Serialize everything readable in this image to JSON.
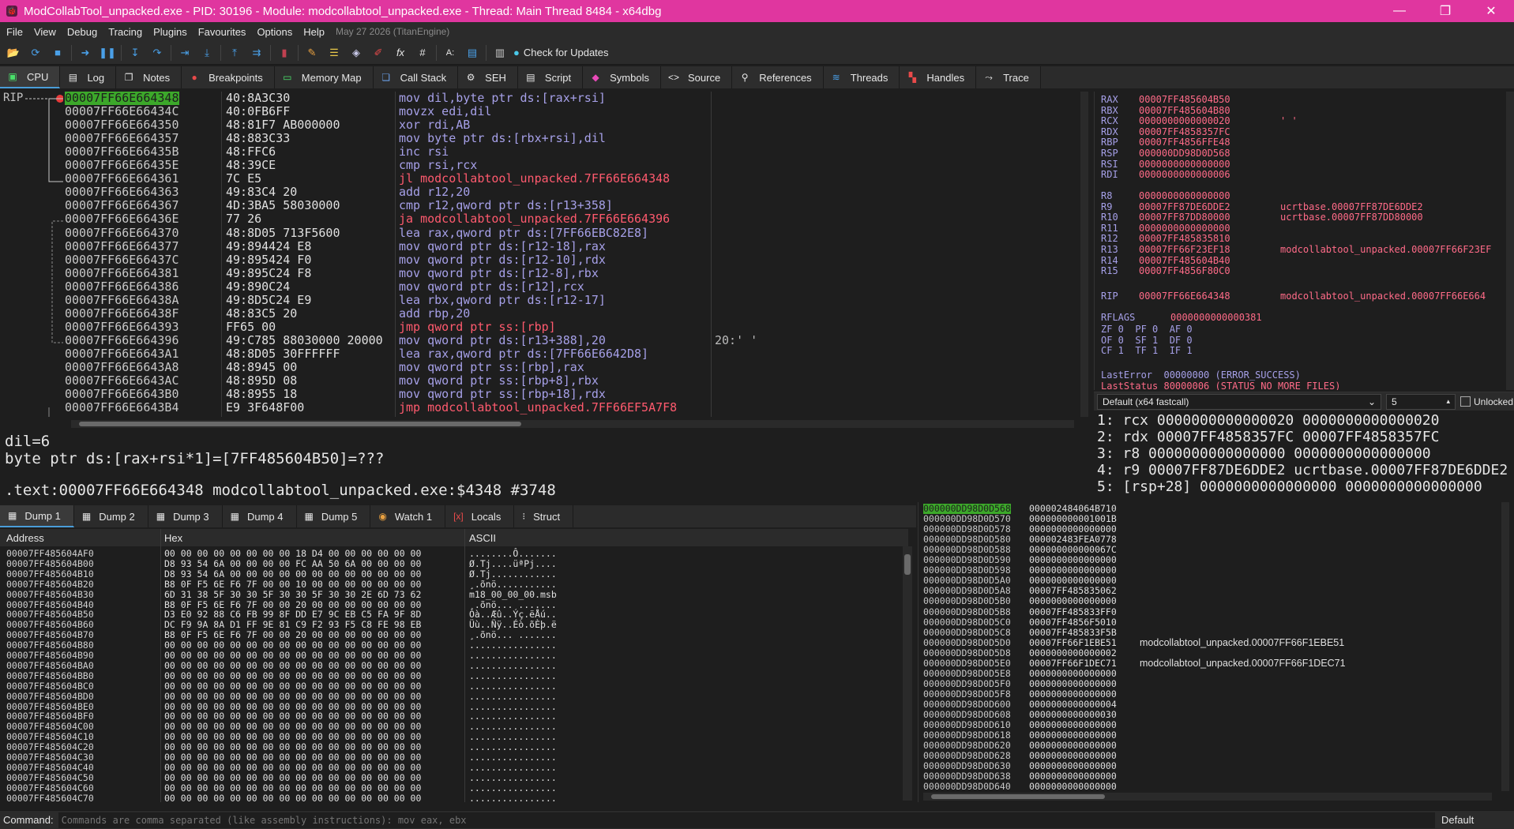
{
  "window": {
    "title": "ModCollabTool_unpacked.exe - PID: 30196 - Module: modcollabtool_unpacked.exe - Thread: Main Thread 8484 - x64dbg",
    "controls": [
      "—",
      "❐",
      "✕"
    ]
  },
  "menu": {
    "items": [
      "File",
      "View",
      "Debug",
      "Tracing",
      "Plugins",
      "Favourites",
      "Options",
      "Help"
    ],
    "date": "May 27 2026 (TitanEngine)"
  },
  "toolbar": {
    "check_updates": "Check for Updates"
  },
  "tabs": [
    "CPU",
    "Log",
    "Notes",
    "Breakpoints",
    "Memory Map",
    "Call Stack",
    "SEH",
    "Script",
    "Symbols",
    "Source",
    "References",
    "Threads",
    "Handles",
    "Trace"
  ],
  "disasm": {
    "rip_label": "RIP",
    "lines": [
      {
        "addr": "00007FF66E664348",
        "bytes": "40:8A3C30",
        "mnem": "mov",
        "ops": " dil,byte ptr ds:[rax+rsi]",
        "type": "mov",
        "cmt": ""
      },
      {
        "addr": "00007FF66E66434C",
        "bytes": "40:0FB6FF",
        "mnem": "movzx",
        "ops": " edi,dil",
        "type": "mov",
        "cmt": ""
      },
      {
        "addr": "00007FF66E664350",
        "bytes": "48:81F7 AB000000",
        "mnem": "xor",
        "ops": " rdi,AB",
        "type": "mov",
        "cmt": ""
      },
      {
        "addr": "00007FF66E664357",
        "bytes": "48:883C33",
        "mnem": "mov",
        "ops": " byte ptr ds:[rbx+rsi],dil",
        "type": "mov",
        "cmt": ""
      },
      {
        "addr": "00007FF66E66435B",
        "bytes": "48:FFC6",
        "mnem": "inc",
        "ops": " rsi",
        "type": "mov",
        "cmt": ""
      },
      {
        "addr": "00007FF66E66435E",
        "bytes": "48:39CE",
        "mnem": "cmp",
        "ops": " rsi,rcx",
        "type": "mov",
        "cmt": ""
      },
      {
        "addr": "00007FF66E664361",
        "bytes": "7C E5",
        "mnem": "jl",
        "ops": " modcollabtool_unpacked.7FF66E664348",
        "type": "jmp",
        "cmt": ""
      },
      {
        "addr": "00007FF66E664363",
        "bytes": "49:83C4 20",
        "mnem": "add",
        "ops": " r12,20",
        "type": "mov",
        "cmt": ""
      },
      {
        "addr": "00007FF66E664367",
        "bytes": "4D:3BA5 58030000",
        "mnem": "cmp",
        "ops": " r12,qword ptr ds:[r13+358]",
        "type": "mov",
        "cmt": ""
      },
      {
        "addr": "00007FF66E66436E",
        "bytes": "77 26",
        "mnem": "ja",
        "ops": " modcollabtool_unpacked.7FF66E664396",
        "type": "jmp",
        "cmt": ""
      },
      {
        "addr": "00007FF66E664370",
        "bytes": "48:8D05 713F5600",
        "mnem": "lea",
        "ops": " rax,qword ptr ds:[7FF66EBC82E8]",
        "type": "mov",
        "cmt": ""
      },
      {
        "addr": "00007FF66E664377",
        "bytes": "49:894424 E8",
        "mnem": "mov",
        "ops": " qword ptr ds:[r12-18],rax",
        "type": "mov",
        "cmt": ""
      },
      {
        "addr": "00007FF66E66437C",
        "bytes": "49:895424 F0",
        "mnem": "mov",
        "ops": " qword ptr ds:[r12-10],rdx",
        "type": "mov",
        "cmt": ""
      },
      {
        "addr": "00007FF66E664381",
        "bytes": "49:895C24 F8",
        "mnem": "mov",
        "ops": " qword ptr ds:[r12-8],rbx",
        "type": "mov",
        "cmt": ""
      },
      {
        "addr": "00007FF66E664386",
        "bytes": "49:890C24",
        "mnem": "mov",
        "ops": " qword ptr ds:[r12],rcx",
        "type": "mov",
        "cmt": ""
      },
      {
        "addr": "00007FF66E66438A",
        "bytes": "49:8D5C24 E9",
        "mnem": "lea",
        "ops": " rbx,qword ptr ds:[r12-17]",
        "type": "mov",
        "cmt": ""
      },
      {
        "addr": "00007FF66E66438F",
        "bytes": "48:83C5 20",
        "mnem": "add",
        "ops": " rbp,20",
        "type": "mov",
        "cmt": ""
      },
      {
        "addr": "00007FF66E664393",
        "bytes": "FF65 00",
        "mnem": "jmp",
        "ops": " qword ptr ss:[rbp]",
        "type": "jmp",
        "cmt": ""
      },
      {
        "addr": "00007FF66E664396",
        "bytes": "49:C785 88030000 20000",
        "mnem": "mov",
        "ops": " qword ptr ds:[r13+388],20",
        "type": "mov",
        "cmt": "20:' '"
      },
      {
        "addr": "00007FF66E6643A1",
        "bytes": "48:8D05 30FFFFFF",
        "mnem": "lea",
        "ops": " rax,qword ptr ds:[7FF66E6642D8]",
        "type": "mov",
        "cmt": ""
      },
      {
        "addr": "00007FF66E6643A8",
        "bytes": "48:8945 00",
        "mnem": "mov",
        "ops": " qword ptr ss:[rbp],rax",
        "type": "mov",
        "cmt": ""
      },
      {
        "addr": "00007FF66E6643AC",
        "bytes": "48:895D 08",
        "mnem": "mov",
        "ops": " qword ptr ss:[rbp+8],rbx",
        "type": "mov",
        "cmt": ""
      },
      {
        "addr": "00007FF66E6643B0",
        "bytes": "48:8955 18",
        "mnem": "mov",
        "ops": " qword ptr ss:[rbp+18],rdx",
        "type": "mov",
        "cmt": ""
      },
      {
        "addr": "00007FF66E6643B4",
        "bytes": "E9 3F648F00",
        "mnem": "jmp",
        "ops": " modcollabtool_unpacked.7FF66EF5A7F8",
        "type": "jmp",
        "cmt": ""
      }
    ]
  },
  "info": {
    "line1": "dil=6",
    "line2": "byte ptr ds:[rax+rsi*1]=[7FF485604B50]=???",
    "line3": ".text:00007FF66E664348 modcollabtool_unpacked.exe:$4348 #3748"
  },
  "registers": {
    "gp": [
      {
        "name": "RAX",
        "value": "00007FF485604B50",
        "extra": ""
      },
      {
        "name": "RBX",
        "value": "00007FF485604B80",
        "extra": ""
      },
      {
        "name": "RCX",
        "value": "0000000000000020",
        "extra": "' '"
      },
      {
        "name": "RDX",
        "value": "00007FF4858357FC",
        "extra": ""
      },
      {
        "name": "RBP",
        "value": "00007FF4856FFE48",
        "extra": ""
      },
      {
        "name": "RSP",
        "value": "000000DD98D0D568",
        "extra": ""
      },
      {
        "name": "RSI",
        "value": "0000000000000000",
        "extra": ""
      },
      {
        "name": "RDI",
        "value": "0000000000000006",
        "extra": ""
      }
    ],
    "ext": [
      {
        "name": "R8",
        "value": "0000000000000000",
        "extra": ""
      },
      {
        "name": "R9",
        "value": "00007FF87DE6DDE2",
        "extra": "ucrtbase.00007FF87DE6DDE2"
      },
      {
        "name": "R10",
        "value": "00007FF87DD80000",
        "extra": "ucrtbase.00007FF87DD80000"
      },
      {
        "name": "R11",
        "value": "0000000000000000",
        "extra": ""
      },
      {
        "name": "R12",
        "value": "00007FF485835810",
        "extra": ""
      },
      {
        "name": "R13",
        "value": "00007FF66F23EF18",
        "extra": "modcollabtool_unpacked.00007FF66F23EF"
      },
      {
        "name": "R14",
        "value": "00007FF485604B40",
        "extra": ""
      },
      {
        "name": "R15",
        "value": "00007FF4856F80C0",
        "extra": ""
      }
    ],
    "rip": {
      "name": "RIP",
      "value": "00007FF66E664348",
      "extra": "modcollabtool_unpacked.00007FF66E664"
    },
    "rflags_label": "RFLAGS",
    "rflags_value": "0000000000000381",
    "flags": [
      "ZF 0  PF 0  AF 0",
      "OF 0  SF 1  DF 0",
      "CF 1  TF 1  IF 1"
    ],
    "last_error": "LastError  00000000 (ERROR_SUCCESS)",
    "last_status": "LastStatus 80000006 (STATUS_NO_MORE_FILES)"
  },
  "callconv": {
    "convention": "Default (x64 fastcall)",
    "count": "5",
    "unlocked": "Unlocked",
    "args": [
      "1: rcx 0000000000000020 0000000000000020",
      "2: rdx 00007FF4858357FC 00007FF4858357FC",
      "3: r8 0000000000000000 0000000000000000",
      "4: r9 00007FF87DE6DDE2 ucrtbase.00007FF87DE6DDE2",
      "5: [rsp+28] 0000000000000000 0000000000000000"
    ]
  },
  "dumptabs": [
    "Dump 1",
    "Dump 2",
    "Dump 3",
    "Dump 4",
    "Dump 5",
    "Watch 1",
    "Locals",
    "Struct"
  ],
  "dump": {
    "headers": {
      "address": "Address",
      "hex": "Hex",
      "ascii": "ASCII"
    },
    "rows": [
      {
        "a": "00007FF485604AF0",
        "h": "00 00 00 00 00 00 00 00 18 D4 00 00 00 00 00 00",
        "s": "........Ô......."
      },
      {
        "a": "00007FF485604B00",
        "h": "D8 93 54 6A 00 00 00 00 FC AA 50 6A 00 00 00 00",
        "s": "Ø.Tj....üªPj...."
      },
      {
        "a": "00007FF485604B10",
        "h": "D8 93 54 6A 00 00 00 00 00 00 00 00 00 00 00 00",
        "s": "Ø.Tj............"
      },
      {
        "a": "00007FF485604B20",
        "h": "B8 0F F5 6E F6 7F 00 00 10 00 00 00 00 00 00 00",
        "s": "¸.õnö..........."
      },
      {
        "a": "00007FF485604B30",
        "h": "6D 31 38 5F 30 30 5F 30 30 5F 30 30 2E 6D 73 62",
        "s": "m18_00_00_00.msb"
      },
      {
        "a": "00007FF485604B40",
        "h": "B8 0F F5 6E F6 7F 00 00 20 00 00 00 00 00 00 00",
        "s": "¸.õnö... ......."
      },
      {
        "a": "00007FF485604B50",
        "h": "D3 E0 92 88 C6 FB 99 8F DD E7 9C EB C5 FA 9F 8D",
        "s": "Óà..Æû..Ýç.ëÅú.."
      },
      {
        "a": "00007FF485604B60",
        "h": "DC F9 9A 8A D1 FF 9E 81 C9 F2 93 F5 C8 FE 98 EB",
        "s": "Üù..Ñÿ..Éò.õÈþ.ë"
      },
      {
        "a": "00007FF485604B70",
        "h": "B8 0F F5 6E F6 7F 00 00 20 00 00 00 00 00 00 00",
        "s": "¸.õnö... ......."
      },
      {
        "a": "00007FF485604B80",
        "h": "00 00 00 00 00 00 00 00 00 00 00 00 00 00 00 00",
        "s": "................"
      },
      {
        "a": "00007FF485604B90",
        "h": "00 00 00 00 00 00 00 00 00 00 00 00 00 00 00 00",
        "s": "................"
      },
      {
        "a": "00007FF485604BA0",
        "h": "00 00 00 00 00 00 00 00 00 00 00 00 00 00 00 00",
        "s": "................"
      },
      {
        "a": "00007FF485604BB0",
        "h": "00 00 00 00 00 00 00 00 00 00 00 00 00 00 00 00",
        "s": "................"
      },
      {
        "a": "00007FF485604BC0",
        "h": "00 00 00 00 00 00 00 00 00 00 00 00 00 00 00 00",
        "s": "................"
      },
      {
        "a": "00007FF485604BD0",
        "h": "00 00 00 00 00 00 00 00 00 00 00 00 00 00 00 00",
        "s": "................"
      },
      {
        "a": "00007FF485604BE0",
        "h": "00 00 00 00 00 00 00 00 00 00 00 00 00 00 00 00",
        "s": "................"
      },
      {
        "a": "00007FF485604BF0",
        "h": "00 00 00 00 00 00 00 00 00 00 00 00 00 00 00 00",
        "s": "................"
      },
      {
        "a": "00007FF485604C00",
        "h": "00 00 00 00 00 00 00 00 00 00 00 00 00 00 00 00",
        "s": "................"
      },
      {
        "a": "00007FF485604C10",
        "h": "00 00 00 00 00 00 00 00 00 00 00 00 00 00 00 00",
        "s": "................"
      },
      {
        "a": "00007FF485604C20",
        "h": "00 00 00 00 00 00 00 00 00 00 00 00 00 00 00 00",
        "s": "................"
      },
      {
        "a": "00007FF485604C30",
        "h": "00 00 00 00 00 00 00 00 00 00 00 00 00 00 00 00",
        "s": "................"
      },
      {
        "a": "00007FF485604C40",
        "h": "00 00 00 00 00 00 00 00 00 00 00 00 00 00 00 00",
        "s": "................"
      },
      {
        "a": "00007FF485604C50",
        "h": "00 00 00 00 00 00 00 00 00 00 00 00 00 00 00 00",
        "s": "................"
      },
      {
        "a": "00007FF485604C60",
        "h": "00 00 00 00 00 00 00 00 00 00 00 00 00 00 00 00",
        "s": "................"
      },
      {
        "a": "00007FF485604C70",
        "h": "00 00 00 00 00 00 00 00 00 00 00 00 00 00 00 00",
        "s": "................"
      }
    ]
  },
  "stack": {
    "rows": [
      {
        "a": "000000DD98D0D568",
        "v": "000002484064B710",
        "c": ""
      },
      {
        "a": "000000DD98D0D570",
        "v": "000000000001001B",
        "c": ""
      },
      {
        "a": "000000DD98D0D578",
        "v": "0000000000000000",
        "c": ""
      },
      {
        "a": "000000DD98D0D580",
        "v": "000002483FEA0778",
        "c": ""
      },
      {
        "a": "000000DD98D0D588",
        "v": "000000000000067C",
        "c": ""
      },
      {
        "a": "000000DD98D0D590",
        "v": "0000000000000000",
        "c": ""
      },
      {
        "a": "000000DD98D0D598",
        "v": "0000000000000000",
        "c": ""
      },
      {
        "a": "000000DD98D0D5A0",
        "v": "0000000000000000",
        "c": ""
      },
      {
        "a": "000000DD98D0D5A8",
        "v": "00007FF485835062",
        "c": ""
      },
      {
        "a": "000000DD98D0D5B0",
        "v": "0000000000000000",
        "c": ""
      },
      {
        "a": "000000DD98D0D5B8",
        "v": "00007FF485833FF0",
        "c": ""
      },
      {
        "a": "000000DD98D0D5C0",
        "v": "00007FF4856F5010",
        "c": ""
      },
      {
        "a": "000000DD98D0D5C8",
        "v": "00007FF485833F5B",
        "c": ""
      },
      {
        "a": "000000DD98D0D5D0",
        "v": "00007FF66F1EBE51",
        "c": "modcollabtool_unpacked.00007FF66F1EBE51"
      },
      {
        "a": "000000DD98D0D5D8",
        "v": "0000000000000002",
        "c": ""
      },
      {
        "a": "000000DD98D0D5E0",
        "v": "00007FF66F1DEC71",
        "c": "modcollabtool_unpacked.00007FF66F1DEC71"
      },
      {
        "a": "000000DD98D0D5E8",
        "v": "0000000000000000",
        "c": ""
      },
      {
        "a": "000000DD98D0D5F0",
        "v": "0000000000000000",
        "c": ""
      },
      {
        "a": "000000DD98D0D5F8",
        "v": "0000000000000000",
        "c": ""
      },
      {
        "a": "000000DD98D0D600",
        "v": "0000000000000004",
        "c": ""
      },
      {
        "a": "000000DD98D0D608",
        "v": "0000000000000030",
        "c": ""
      },
      {
        "a": "000000DD98D0D610",
        "v": "0000000000000000",
        "c": ""
      },
      {
        "a": "000000DD98D0D618",
        "v": "0000000000000000",
        "c": ""
      },
      {
        "a": "000000DD98D0D620",
        "v": "0000000000000000",
        "c": ""
      },
      {
        "a": "000000DD98D0D628",
        "v": "0000000000000000",
        "c": ""
      },
      {
        "a": "000000DD98D0D630",
        "v": "0000000000000000",
        "c": ""
      },
      {
        "a": "000000DD98D0D638",
        "v": "0000000000000000",
        "c": ""
      },
      {
        "a": "000000DD98D0D640",
        "v": "0000000000000000",
        "c": ""
      }
    ]
  },
  "command": {
    "label": "Command:",
    "placeholder": "Commands are comma separated (like assembly instructions): mov eax, ebx",
    "mode": "Default"
  },
  "colors": {
    "titlebar": "#e0369f",
    "selection": "#3ca82a",
    "mnemonic": "#a6a0e8",
    "jump": "#ff5a6e",
    "register_value": "#ff6b88"
  }
}
